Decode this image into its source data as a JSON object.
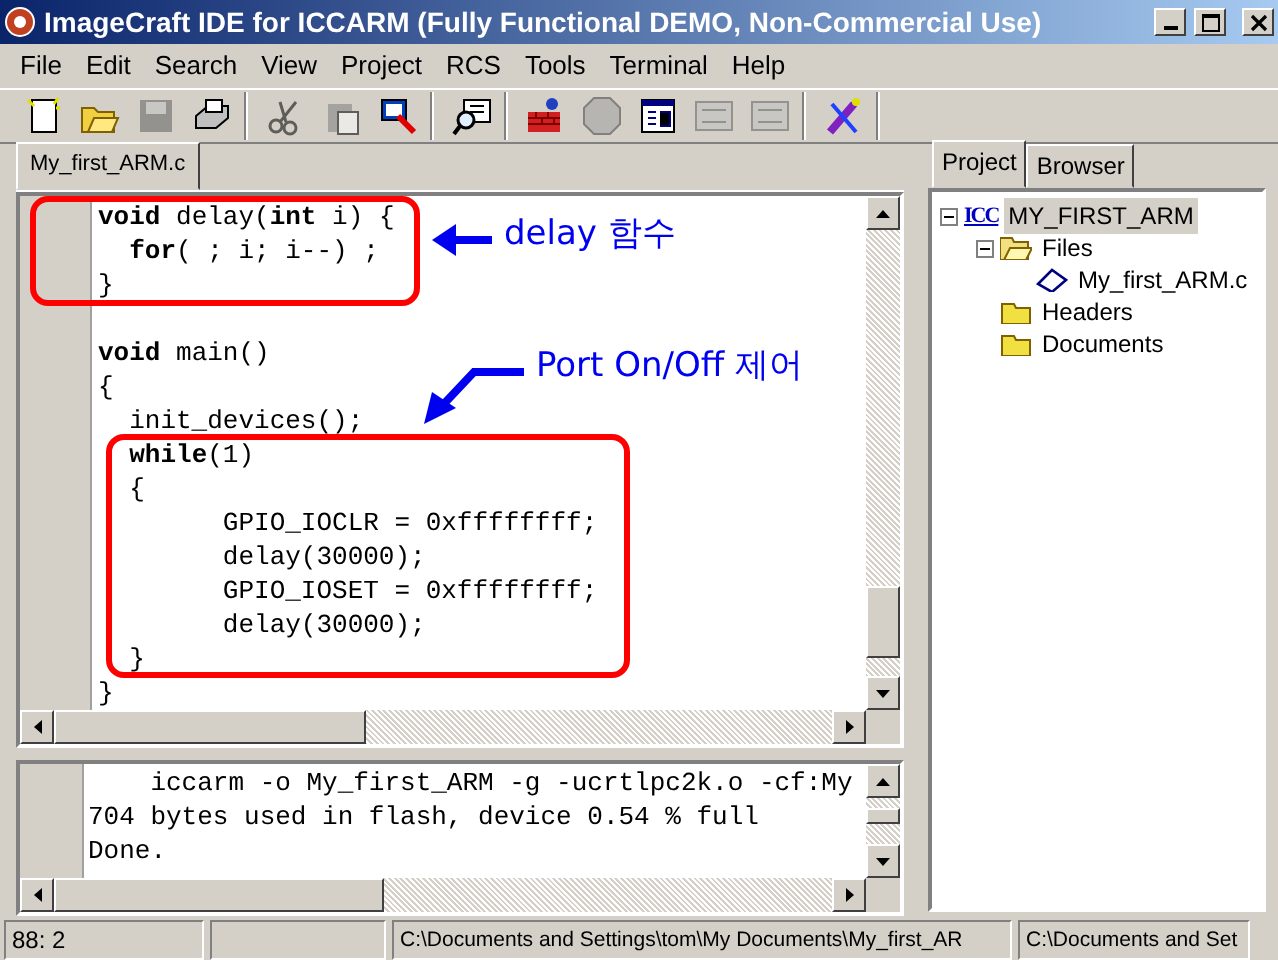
{
  "window": {
    "title": "ImageCraft IDE for ICCARM (Fully Functional DEMO, Non-Commercial Use)"
  },
  "menu": [
    "File",
    "Edit",
    "Search",
    "View",
    "Project",
    "RCS",
    "Tools",
    "Terminal",
    "Help"
  ],
  "toolbar": [
    [
      {
        "kind": "new",
        "disabled": false
      },
      {
        "kind": "open",
        "disabled": false
      },
      {
        "kind": "save",
        "disabled": true
      },
      {
        "kind": "print",
        "disabled": false
      }
    ],
    [
      {
        "kind": "cut",
        "disabled": true
      },
      {
        "kind": "paste",
        "disabled": true
      },
      {
        "kind": "target",
        "disabled": false
      }
    ],
    [
      {
        "kind": "browse",
        "disabled": false
      }
    ],
    [
      {
        "kind": "build",
        "disabled": false
      },
      {
        "kind": "stop",
        "disabled": true
      },
      {
        "kind": "view",
        "disabled": false
      },
      {
        "kind": "err",
        "disabled": true
      },
      {
        "kind": "err",
        "disabled": true
      }
    ],
    [
      {
        "kind": "wand",
        "disabled": false
      }
    ]
  ],
  "editor": {
    "tabs": [
      {
        "label": "My_first_ARM.c",
        "selected": true
      }
    ],
    "code_blocks": [
      [
        "**void** delay(**int** i) {",
        "  **for**( ; i; i--) ;",
        "}"
      ],
      [
        "**void** main()",
        "{",
        "  init_devices();",
        "  **while**(1)",
        "  {",
        "        GPIO_IOCLR = 0xffffffff;",
        "        delay(30000);",
        "        GPIO_IOSET = 0xffffffff;",
        "        delay(30000);",
        "  }",
        "}"
      ]
    ],
    "annotations": [
      {
        "kind": "left",
        "text": "delay 함수"
      },
      {
        "kind": "down",
        "text": "Port On/Off 제어"
      }
    ]
  },
  "output": {
    "lines": [
      "    iccarm -o My_first_ARM -g -ucrtlpc2k.o -cf:My",
      "704 bytes used in flash, device 0.54 % full",
      "Done."
    ]
  },
  "side_panel": {
    "tabs": [
      {
        "label": "Project",
        "selected": true
      },
      {
        "label": "Browser",
        "selected": false
      }
    ],
    "tree": [
      {
        "kind": "project",
        "icon_label": "ICC",
        "label": "MY_FIRST_ARM",
        "selected": true,
        "expanded": true,
        "children": [
          {
            "kind": "folder",
            "label": "Files",
            "selected": false,
            "expanded": true,
            "children": [
              {
                "kind": "file",
                "label": "My_first_ARM.c",
                "selected": false
              }
            ]
          },
          {
            "kind": "folder",
            "label": "Headers",
            "selected": false,
            "expanded": false
          },
          {
            "kind": "folder",
            "label": "Documents",
            "selected": false,
            "expanded": false
          }
        ]
      }
    ]
  },
  "status_bar": {
    "position": "88: 2",
    "path": "C:\\Documents and Settings\\tom\\My Documents\\My_first_AR",
    "path_2": "C:\\Documents and Set"
  }
}
